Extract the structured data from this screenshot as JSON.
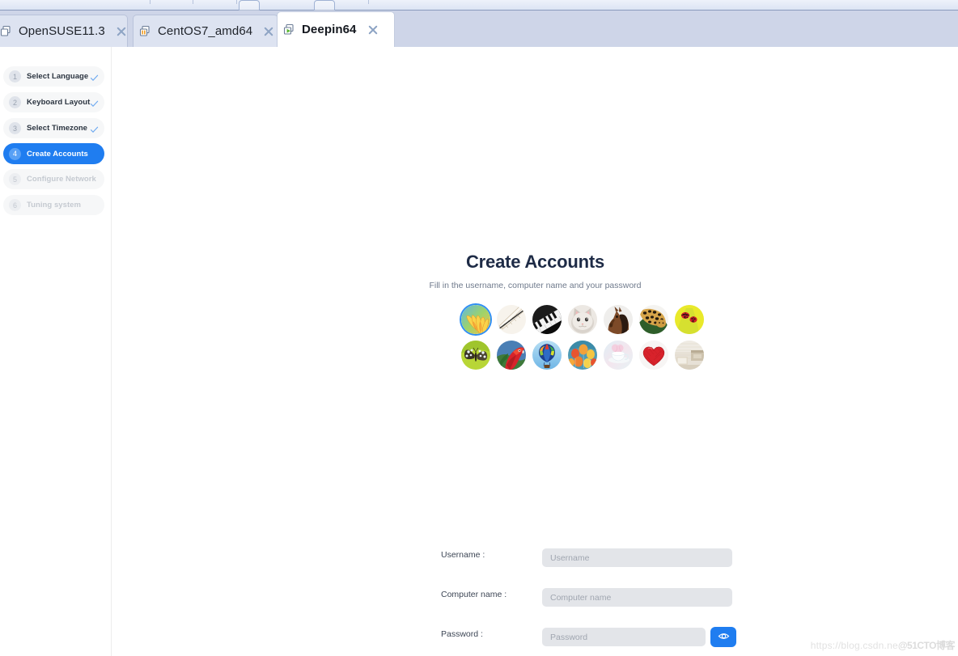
{
  "window": {
    "tabs": [
      {
        "label": "OpenSUSE11.3",
        "icon": "stacked-squares-icon",
        "state": "powered-off",
        "active": false,
        "close_icon": "close-icon"
      },
      {
        "label": "CentOS7_amd64",
        "icon": "paused-vm-icon",
        "state": "paused",
        "active": false,
        "close_icon": "close-icon"
      },
      {
        "label": "Deepin64",
        "icon": "running-vm-icon",
        "state": "running",
        "active": true,
        "close_icon": "close-icon"
      }
    ]
  },
  "sidebar": {
    "steps": [
      {
        "num": "1",
        "label": "Select Language",
        "state": "done",
        "check_icon": "check-icon"
      },
      {
        "num": "2",
        "label": "Keyboard Layout",
        "state": "done",
        "check_icon": "check-icon"
      },
      {
        "num": "3",
        "label": "Select Timezone",
        "state": "done",
        "check_icon": "check-icon"
      },
      {
        "num": "4",
        "label": "Create Accounts",
        "state": "active",
        "check_icon": ""
      },
      {
        "num": "5",
        "label": "Configure Network",
        "state": "disabled",
        "check_icon": ""
      },
      {
        "num": "6",
        "label": "Tuning system",
        "state": "disabled",
        "check_icon": ""
      }
    ]
  },
  "main": {
    "title": "Create Accounts",
    "subtitle": "Fill in the username, computer name and your password",
    "avatars": [
      [
        {
          "name": "avatar-flower",
          "selected": true
        },
        {
          "name": "avatar-fan",
          "selected": false
        },
        {
          "name": "avatar-piano",
          "selected": false
        },
        {
          "name": "avatar-kitten",
          "selected": false
        },
        {
          "name": "avatar-horse",
          "selected": false
        },
        {
          "name": "avatar-leopard",
          "selected": false
        },
        {
          "name": "avatar-ladybug",
          "selected": false
        }
      ],
      [
        {
          "name": "avatar-butterfly",
          "selected": false
        },
        {
          "name": "avatar-parrot",
          "selected": false
        },
        {
          "name": "avatar-hot-air-balloon",
          "selected": false
        },
        {
          "name": "avatar-balloons",
          "selected": false
        },
        {
          "name": "avatar-teacup",
          "selected": false
        },
        {
          "name": "avatar-heart",
          "selected": false
        },
        {
          "name": "avatar-room",
          "selected": false
        }
      ]
    ],
    "form": {
      "username": {
        "label": "Username :",
        "value": "",
        "placeholder": "Username"
      },
      "computer_name": {
        "label": "Computer name :",
        "value": "",
        "placeholder": "Computer name"
      },
      "password": {
        "label": "Password :",
        "value": "",
        "placeholder": "Password",
        "reveal_icon": "eye-icon"
      }
    }
  },
  "watermark": {
    "url": "https://blog.csdn.ne",
    "brand": "@51CTO博客"
  },
  "colors": {
    "accent": "#1f7df0",
    "tabstrip": "#ced5e8",
    "input_bg": "#e3e5e9",
    "title": "#1e2b46"
  }
}
